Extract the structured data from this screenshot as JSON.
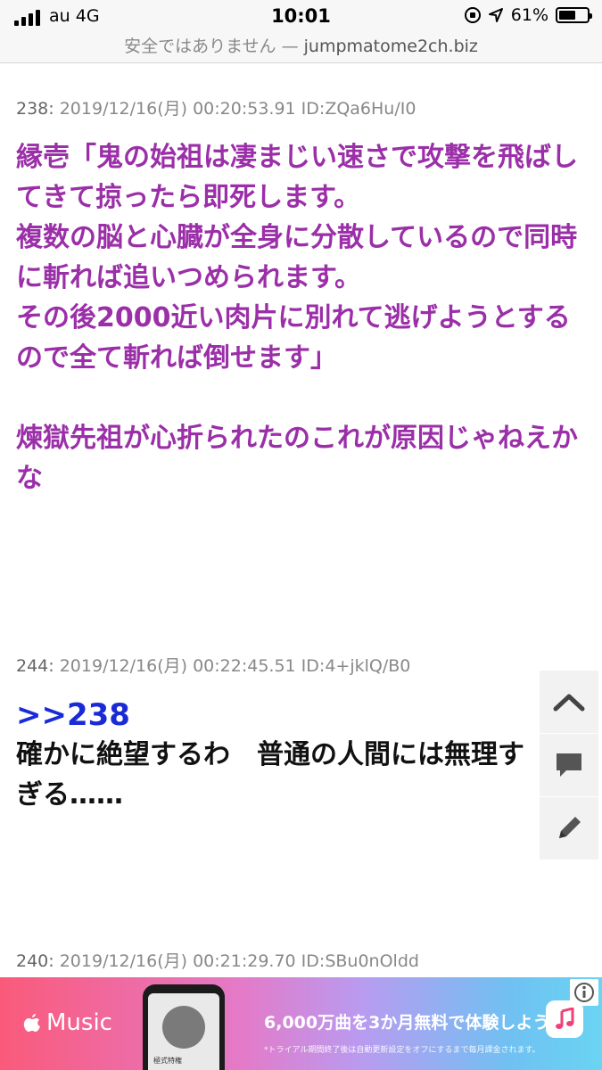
{
  "status_bar": {
    "carrier": "au 4G",
    "time": "10:01",
    "battery_percent": "61%",
    "battery_level": 0.61,
    "security_text": "安全ではありません",
    "separator": "—",
    "domain": "jumpmatome2ch.biz"
  },
  "posts": [
    {
      "number": "238:",
      "meta": "2019/12/16(月) 00:20:53.91 ID:ZQa6Hu/I0",
      "color": "#9b2fa8",
      "paragraphs": [
        "縁壱「鬼の始祖は凄まじい速さで攻撃を飛ばしてきて掠ったら即死します。",
        "複数の脳と心臓が全身に分散しているので同時に斬れば追いつめられます。",
        "その後2000近い肉片に別れて逃げようとするので全て斬れば倒せます」",
        "",
        "煉獄先祖が心折られたのこれが原因じゃねえかな"
      ]
    },
    {
      "number": "244:",
      "meta": "2019/12/16(月) 00:22:45.51 ID:4+jklQ/B0",
      "reply_link": ">>238",
      "reply_color": "#1a2bd6",
      "paragraphs": [
        "確かに絶望するわ　普通の人間には無理すぎる……"
      ]
    },
    {
      "number": "240:",
      "meta": "2019/12/16(月) 00:21:29.70 ID:SBu0nOldd"
    }
  ],
  "floating_buttons": {
    "scroll_top_icon": "chevron-up-icon",
    "comment_icon": "comment-icon",
    "edit_icon": "pencil-icon"
  },
  "ad": {
    "brand": "Music",
    "headline": "6,000万曲を3か月無料で体験しよう。",
    "fine_print": "*トライアル期間終了後は自動更新設定をオフにするまで毎月課金されます。",
    "info_icon": "info-icon",
    "phone_tag": "極式特権"
  }
}
